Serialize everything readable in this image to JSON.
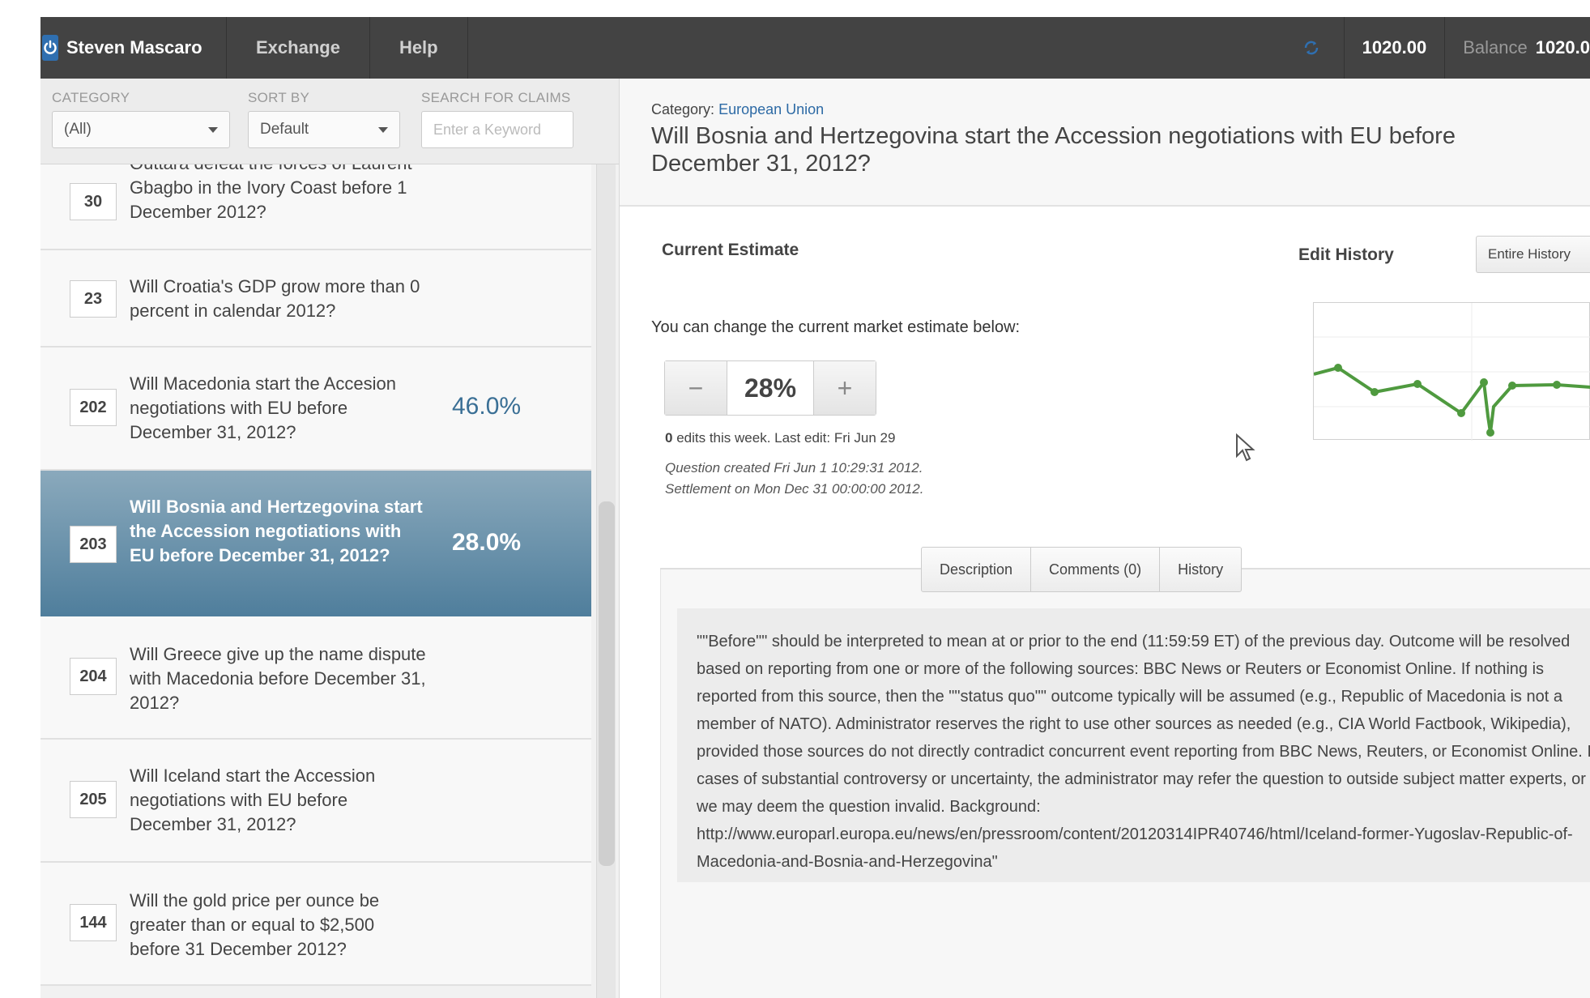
{
  "topbar": {
    "user_name": "Steven Mascaro",
    "nav": [
      "Exchange",
      "Help"
    ],
    "amount": "1020.00",
    "balance_label": "Balance",
    "balance_value": "1020.0"
  },
  "filters": {
    "category_label": "CATEGORY",
    "category_value": "(All)",
    "sort_label": "SORT BY",
    "sort_value": "Default",
    "search_label": "SEARCH FOR CLAIMS",
    "search_placeholder": "Enter a Keyword"
  },
  "claims": [
    {
      "id": "30",
      "text": "Outtara defeat the forces of Laurent Gbagbo in the Ivory Coast before 1 December 2012?",
      "pct": ""
    },
    {
      "id": "23",
      "text": "Will Croatia's GDP grow more than 0 percent in calendar 2012?",
      "pct": ""
    },
    {
      "id": "202",
      "text": "Will Macedonia start the Accesion negotiations with EU before December 31, 2012?",
      "pct": "46.0%"
    },
    {
      "id": "203",
      "text": "Will Bosnia and Hertzegovina start the Accession negotiations with EU before December 31, 2012?",
      "pct": "28.0%"
    },
    {
      "id": "204",
      "text": "Will Greece give up the name dispute with Macedonia before December 31, 2012?",
      "pct": ""
    },
    {
      "id": "205",
      "text": "Will Iceland start the Accession negotiations with EU before December 31, 2012?",
      "pct": ""
    },
    {
      "id": "144",
      "text": "Will the gold price per ounce be greater than or equal to $2,500 before 31 December 2012?",
      "pct": ""
    }
  ],
  "question": {
    "category_label": "Category:",
    "category_value": "European Union",
    "title": "Will Bosnia and Hertzegovina start the Accession negotiations with EU before December 31, 2012?"
  },
  "estimate": {
    "label": "Current Estimate",
    "change_label": "You can change the current market estimate below:",
    "minus": "−",
    "value": "28%",
    "plus": "+",
    "edits_count": "0",
    "edits_text": "edits this week. Last edit: Fri Jun 29",
    "created": "Question created Fri Jun 1 10:29:31 2012.",
    "settlement": "Settlement on Mon Dec 31 00:00:00 2012."
  },
  "history": {
    "label": "Edit History",
    "button": "Entire History"
  },
  "tabs": [
    "Description",
    "Comments (0)",
    "History"
  ],
  "description": "\"\"Before\"\" should be interpreted to mean at or prior to the end (11:59:59 ET) of the previous day. Outcome will be resolved based on reporting from one or more of the following sources: BBC News or Reuters or Economist Online. If nothing is reported from this source, then the \"\"status quo\"\" outcome typically will be assumed (e.g., Republic of Macedonia is not a member of NATO). Administrator reserves the right to use other sources as needed (e.g., CIA World Factbook, Wikipedia), provided those sources do not directly contradict concurrent event reporting from BBC News, Reuters, or Economist Online. In cases of substantial controversy or uncertainty, the administrator may refer the question to outside subject matter experts, or we may deem the question invalid. Background: http://www.europarl.europa.eu/news/en/pressroom/content/20120314IPR40746/html/Iceland-former-Yugoslav-Republic-of-Macedonia-and-Bosnia-and-Herzegovina\"",
  "colors": {
    "topbar": "#434343",
    "selected_claim": "#4f7e9c",
    "pct_text": "#3a6f95",
    "chart_line": "#4f9a3f",
    "link": "#2d6aa5"
  },
  "icons": [
    "power-icon",
    "refresh-icon",
    "chevron-down-icon",
    "mouse-cursor-icon"
  ]
}
